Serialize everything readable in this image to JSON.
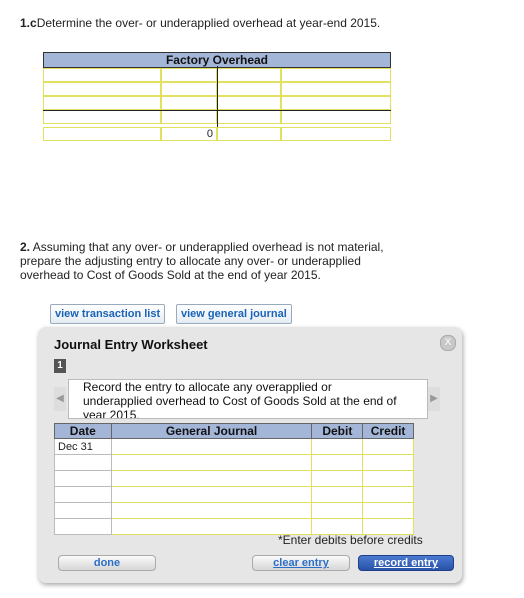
{
  "q1": {
    "number": "1.c",
    "text": "Determine the over- or underapplied overhead at year-end 2015."
  },
  "taccount": {
    "title": "Factory Overhead",
    "total_value": "0"
  },
  "q2": {
    "number": "2.",
    "text": "Assuming that any over- or underapplied overhead is not material, prepare the adjusting entry to allocate any over- or underapplied overhead to Cost of Goods Sold at the end of year 2015."
  },
  "buttons": {
    "view_transaction_list": "view transaction list",
    "view_general_journal": "view general journal"
  },
  "worksheet": {
    "title": "Journal Entry Worksheet",
    "close": "X",
    "step": "1",
    "prompt": "Record the entry to allocate any overapplied or underapplied overhead to Cost of Goods Sold at the end of year 2015.",
    "columns": {
      "date": "Date",
      "general_journal": "General Journal",
      "debit": "Debit",
      "credit": "Credit"
    },
    "first_date": "Dec 31",
    "note": "*Enter debits before credits",
    "done": "done",
    "clear_entry": "clear entry",
    "record_entry": "record entry"
  }
}
